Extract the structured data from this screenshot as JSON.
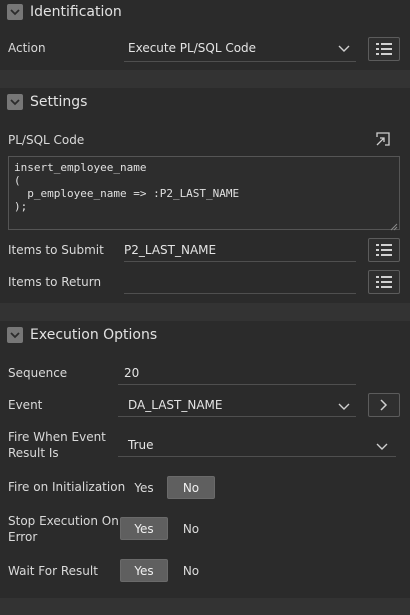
{
  "identification": {
    "title": "Identification",
    "action_label": "Action",
    "action_value": "Execute PL/SQL Code"
  },
  "settings": {
    "title": "Settings",
    "plsql_label": "PL/SQL Code",
    "code_lines": [
      "insert_employee_name",
      "(",
      "  p_employee_name => :P2_LAST_NAME",
      ");"
    ],
    "items_submit_label": "Items to Submit",
    "items_submit_value": "P2_LAST_NAME",
    "items_return_label": "Items to Return",
    "items_return_value": ""
  },
  "execution": {
    "title": "Execution Options",
    "sequence_label": "Sequence",
    "sequence_value": "20",
    "event_label": "Event",
    "event_value": "DA_LAST_NAME",
    "fire_when_label_1": "Fire When Event",
    "fire_when_label_2": "Result Is",
    "fire_when_value": "True",
    "fire_init_label": "Fire on Initialization",
    "fire_init_yes": "Yes",
    "fire_init_no": "No",
    "fire_init_selected": "No",
    "stop_label_1": "Stop Execution On",
    "stop_label_2": "Error",
    "stop_yes": "Yes",
    "stop_no": "No",
    "stop_selected": "Yes",
    "wait_label": "Wait For Result",
    "wait_yes": "Yes",
    "wait_no": "No",
    "wait_selected": "Yes"
  },
  "colors": {
    "background": "#2b2b2b",
    "band": "#333333",
    "toggle_selected": "#5f5f5f"
  }
}
